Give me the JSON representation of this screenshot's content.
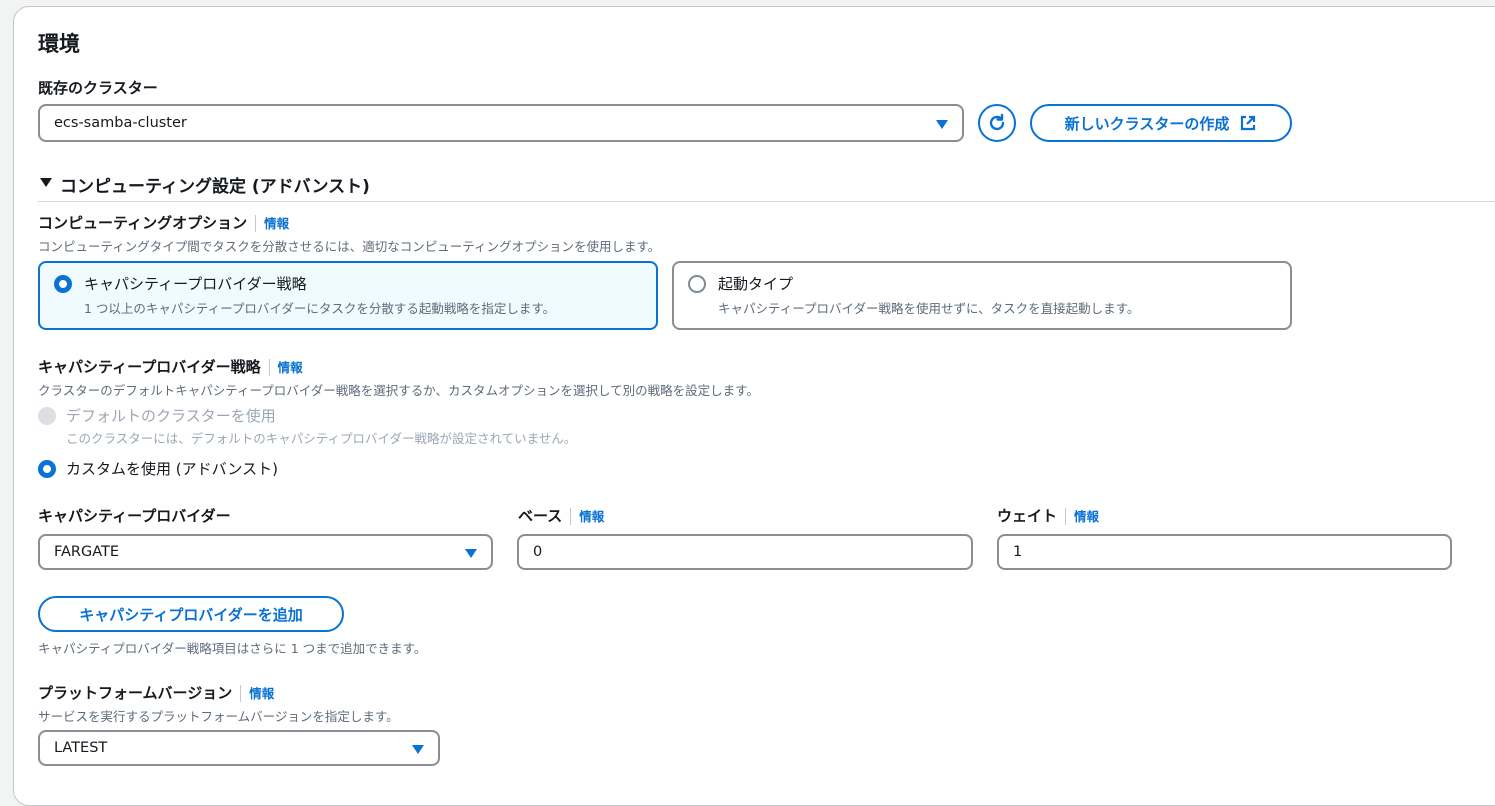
{
  "section_title": "環境",
  "cluster": {
    "label": "既存のクラスター",
    "selected": "ecs-samba-cluster",
    "create_button": "新しいクラスターの作成"
  },
  "compute_settings": {
    "expander_label": "コンピューティング設定 (アドバンスト)",
    "compute_option": {
      "label": "コンピューティングオプション",
      "info": "情報",
      "description": "コンピューティングタイプ間でタスクを分散させるには、適切なコンピューティングオプションを使用します。",
      "options": [
        {
          "title": "キャパシティープロバイダー戦略",
          "desc": "1 つ以上のキャパシティープロバイダーにタスクを分散する起動戦略を指定します。",
          "selected": true
        },
        {
          "title": "起動タイプ",
          "desc": "キャパシティープロバイダー戦略を使用せずに、タスクを直接起動します。",
          "selected": false
        }
      ]
    },
    "strategy": {
      "label": "キャパシティープロバイダー戦略",
      "info": "情報",
      "description": "クラスターのデフォルトキャパシティープロバイダー戦略を選択するか、カスタムオプションを選択して別の戦略を設定します。",
      "default_option": {
        "label": "デフォルトのクラスターを使用",
        "desc": "このクラスターには、デフォルトのキャパシティプロバイダー戦略が設定されていません。",
        "disabled": true
      },
      "custom_option": {
        "label": "カスタムを使用 (アドバンスト)",
        "selected": true
      }
    },
    "provider_row": {
      "provider_label": "キャパシティープロバイダー",
      "provider_value": "FARGATE",
      "base_label": "ベース",
      "base_info": "情報",
      "base_value": "0",
      "weight_label": "ウェイト",
      "weight_info": "情報",
      "weight_value": "1"
    },
    "add_provider_button": "キャパシティプロバイダーを追加",
    "add_provider_hint": "キャパシティプロバイダー戦略項目はさらに 1 つまで追加できます。",
    "platform": {
      "label": "プラットフォームバージョン",
      "info": "情報",
      "description": "サービスを実行するプラットフォームバージョンを指定します。",
      "value": "LATEST"
    }
  },
  "colors": {
    "accent": "#0972d3",
    "selected_tile_bg": "#f0fbff",
    "border": "#8c8c94"
  },
  "icons": {
    "refresh": "refresh-icon",
    "external": "external-link-icon",
    "caret": "caret-down-icon",
    "expander": "triangle-down-icon"
  }
}
